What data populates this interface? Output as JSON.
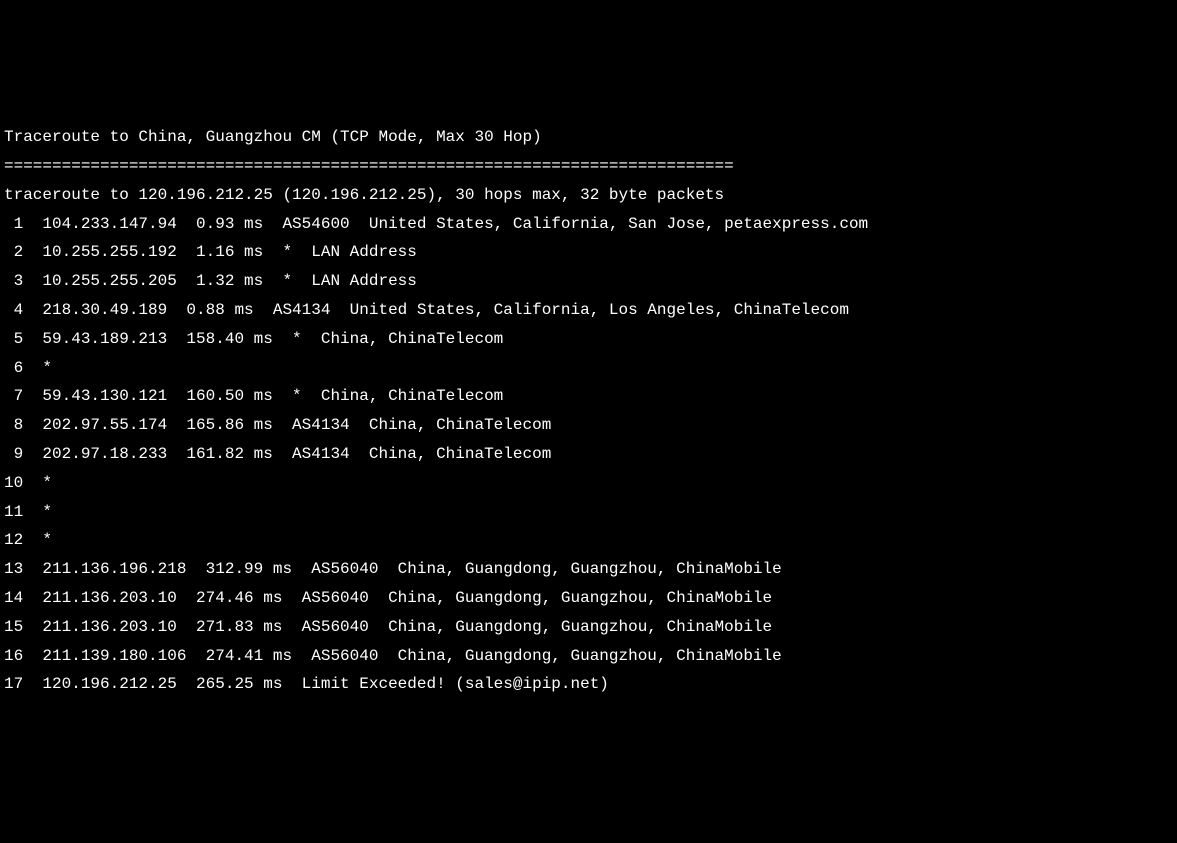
{
  "header": {
    "title": "Traceroute to China, Guangzhou CM (TCP Mode, Max 30 Hop)",
    "separator": "============================================================================"
  },
  "summary": "traceroute to 120.196.212.25 (120.196.212.25), 30 hops max, 32 byte packets",
  "hops": [
    {
      "num": " 1",
      "ip": "104.233.147.94",
      "time": "0.93 ms",
      "asn": "AS54600",
      "location": "United States, California, San Jose, petaexpress.com"
    },
    {
      "num": " 2",
      "ip": "10.255.255.192",
      "time": "1.16 ms",
      "asn": "*",
      "location": "LAN Address"
    },
    {
      "num": " 3",
      "ip": "10.255.255.205",
      "time": "1.32 ms",
      "asn": "*",
      "location": "LAN Address"
    },
    {
      "num": " 4",
      "ip": "218.30.49.189",
      "time": "0.88 ms",
      "asn": "AS4134",
      "location": "United States, California, Los Angeles, ChinaTelecom"
    },
    {
      "num": " 5",
      "ip": "59.43.189.213",
      "time": "158.40 ms",
      "asn": "*",
      "location": "China, ChinaTelecom"
    },
    {
      "num": " 6",
      "ip": "*",
      "time": "",
      "asn": "",
      "location": ""
    },
    {
      "num": " 7",
      "ip": "59.43.130.121",
      "time": "160.50 ms",
      "asn": "*",
      "location": "China, ChinaTelecom"
    },
    {
      "num": " 8",
      "ip": "202.97.55.174",
      "time": "165.86 ms",
      "asn": "AS4134",
      "location": "China, ChinaTelecom"
    },
    {
      "num": " 9",
      "ip": "202.97.18.233",
      "time": "161.82 ms",
      "asn": "AS4134",
      "location": "China, ChinaTelecom"
    },
    {
      "num": "10",
      "ip": "*",
      "time": "",
      "asn": "",
      "location": ""
    },
    {
      "num": "11",
      "ip": "*",
      "time": "",
      "asn": "",
      "location": ""
    },
    {
      "num": "12",
      "ip": "*",
      "time": "",
      "asn": "",
      "location": ""
    },
    {
      "num": "13",
      "ip": "211.136.196.218",
      "time": "312.99 ms",
      "asn": "AS56040",
      "location": "China, Guangdong, Guangzhou, ChinaMobile"
    },
    {
      "num": "14",
      "ip": "211.136.203.10",
      "time": "274.46 ms",
      "asn": "AS56040",
      "location": "China, Guangdong, Guangzhou, ChinaMobile"
    },
    {
      "num": "15",
      "ip": "211.136.203.10",
      "time": "271.83 ms",
      "asn": "AS56040",
      "location": "China, Guangdong, Guangzhou, ChinaMobile"
    },
    {
      "num": "16",
      "ip": "211.139.180.106",
      "time": "274.41 ms",
      "asn": "AS56040",
      "location": "China, Guangdong, Guangzhou, ChinaMobile"
    },
    {
      "num": "17",
      "ip": "120.196.212.25",
      "time": "265.25 ms",
      "asn": "",
      "location": "Limit Exceeded! (sales@ipip.net)"
    }
  ]
}
